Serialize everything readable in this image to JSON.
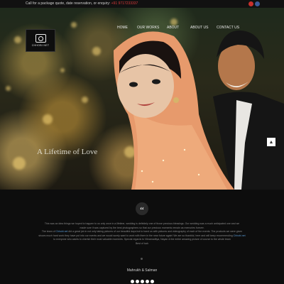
{
  "topbar": {
    "call_text": "Call for a package quote, date reservation, or enquiry:",
    "phone": "+91 9717233337",
    "social_icons": [
      "google-plus-icon",
      "facebook-icon"
    ]
  },
  "brand": {
    "logo_text": "CHHOBI NET",
    "logo_icon": "camera-icon"
  },
  "nav": {
    "items": [
      "HOME",
      "OUR WORKS",
      "ABOUT",
      "ABOUT US",
      "CONTACT US"
    ]
  },
  "hero": {
    "tagline": "A Lifetime of Love"
  },
  "testimonial": {
    "quote_icon": "quote-icon",
    "line1": "This was an idea things we hoped to happen to us only once in a lifetime, wedding is definitely one of those precious blessings. Our wedding was a much anticipated one and we",
    "line2": "made sure it was captured by the best photographers so that our precious moments remain as memories forever.",
    "line3a": "The team of ",
    "line3_link": "Chhobi.net",
    "line3b": " did a great job in not only taking pictures of our beautiful days but to hand us with pictures and videography of each of the events. The products we were given",
    "line4": "shows much hard work they have put into our events and we would surely want to work with them in the near future again! We are so thankful, here and will keep recommending ",
    "line4_link": "Chhobi.net",
    "line5": "to everyone who wants to cherish their most valuable moments. Special regards to Vikramaditya, Nayan & the entire amazing picture of course to the whole team",
    "line6": "Best of luck",
    "author": "Mahrukh & Salman",
    "slider_count": 5
  },
  "ui": {
    "scroll_top_icon": "arrow-up-icon"
  }
}
